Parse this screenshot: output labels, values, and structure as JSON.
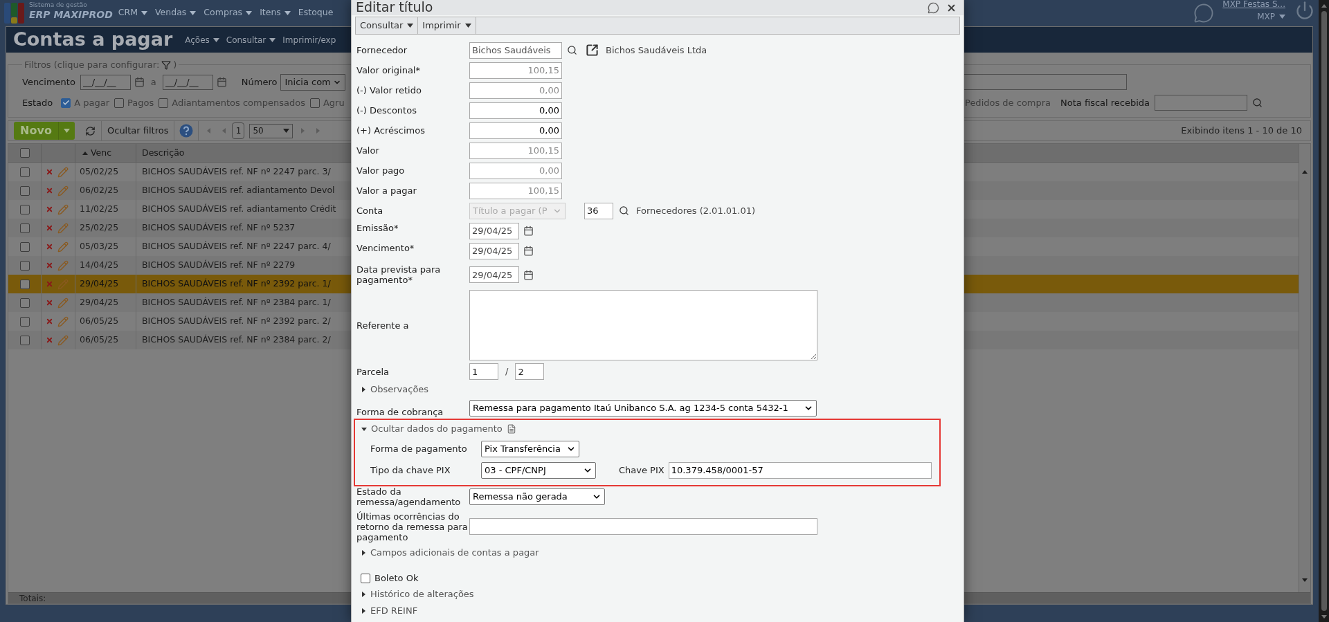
{
  "top_nav": {
    "logo_caption": "Sistema de gestão",
    "logo_text": "ERP MAXIPROD",
    "menu": [
      {
        "label": "CRM",
        "caret": true
      },
      {
        "label": "Vendas",
        "caret": true
      },
      {
        "label": "Compras",
        "caret": true
      },
      {
        "label": "Itens",
        "caret": true
      },
      {
        "label": "Estoque",
        "caret": false
      }
    ],
    "company_link": "MXP Festas S...",
    "user_menu": "MXP"
  },
  "page": {
    "title": "Contas a pagar",
    "menu": [
      {
        "label": "Ações",
        "caret": true
      },
      {
        "label": "Consultar",
        "caret": true
      },
      {
        "label": "Imprimir/exp",
        "caret": false
      }
    ]
  },
  "filters": {
    "legend": "Filtros (clique para configurar:",
    "legend_end": ")",
    "due_label": "Vencimento",
    "date_from": "__/__/__",
    "between": "a",
    "date_to": "__/__/__",
    "number_label": "Número",
    "number_mode": "Inicia com",
    "state_label": "Estado",
    "states": [
      {
        "label": "A pagar",
        "checked": true
      },
      {
        "label": "Pagos",
        "checked": false
      },
      {
        "label": "Adiantamentos compensados",
        "checked": false
      },
      {
        "label": "Agru",
        "checked": false
      }
    ],
    "purchase_orders_label": "Pedidos de compra",
    "invoice_label": "Nota fiscal recebida"
  },
  "toolbar": {
    "new_button": "Novo",
    "hide_filters": "Ocultar filtros",
    "page": "1",
    "page_size": "50",
    "summary": "Exibindo itens 1 - 10 de 10"
  },
  "grid": {
    "all_checked": false,
    "columns": [
      "Venc",
      "Descrição"
    ],
    "rows": [
      {
        "venc": "05/02/25",
        "description": "BICHOS SAUDÁVEIS ref. NF nº 2247 parc. 3/",
        "selected": false,
        "checked": false
      },
      {
        "venc": "06/02/25",
        "description": "BICHOS SAUDÁVEIS ref. adiantamento Devol",
        "selected": false,
        "checked": false
      },
      {
        "venc": "11/02/25",
        "description": "BICHOS SAUDÁVEIS ref. adiantamento Crédit",
        "selected": false,
        "checked": false
      },
      {
        "venc": "25/02/25",
        "description": "BICHOS SAUDÁVEIS ref. NF nº 5237",
        "selected": false,
        "checked": false
      },
      {
        "venc": "05/03/25",
        "description": "BICHOS SAUDÁVEIS ref. NF nº 2247 parc. 4/",
        "selected": false,
        "checked": false
      },
      {
        "venc": "14/04/25",
        "description": "BICHOS SAUDÁVEIS ref. NF nº 2279",
        "selected": false,
        "checked": false
      },
      {
        "venc": "29/04/25",
        "description": "BICHOS SAUDÁVEIS ref. NF nº 2392 parc. 1/",
        "selected": true,
        "checked": false
      },
      {
        "venc": "29/04/25",
        "description": "BICHOS SAUDÁVEIS ref. NF nº 2384 parc. 1/",
        "selected": false,
        "checked": false
      },
      {
        "venc": "06/05/25",
        "description": "BICHOS SAUDÁVEIS ref. NF nº 2392 parc. 2/",
        "selected": false,
        "checked": false
      },
      {
        "venc": "06/05/25",
        "description": "BICHOS SAUDÁVEIS ref. NF nº 2384 parc. 2/",
        "selected": false,
        "checked": false
      }
    ],
    "totals_label": "Totais:"
  },
  "dialog": {
    "title": "Editar título",
    "toolbar": [
      "Consultar",
      "Imprimir"
    ],
    "fields": [
      {
        "kind": "supplier",
        "label": "Fornecedor",
        "value": "Bichos Saudáveis",
        "link": "Bichos Saudáveis Ltda"
      },
      {
        "kind": "amount",
        "label": "Valor original*",
        "value": "100,15",
        "editable": false
      },
      {
        "kind": "amount",
        "label": "(-) Valor retido",
        "value": "0,00",
        "editable": false
      },
      {
        "kind": "amount",
        "label": "(-) Descontos",
        "value": "0,00",
        "editable": true
      },
      {
        "kind": "amount",
        "label": "(+) Acréscimos",
        "value": "0,00",
        "editable": true
      },
      {
        "kind": "amount",
        "label": "Valor",
        "value": "100,15",
        "editable": false
      },
      {
        "kind": "amount",
        "label": "Valor pago",
        "value": "0,00",
        "editable": false
      },
      {
        "kind": "amount",
        "label": "Valor a pagar",
        "value": "100,15",
        "editable": false
      },
      {
        "kind": "account",
        "label": "Conta",
        "value": "Título a pagar (P",
        "disabled": true,
        "code": "36",
        "account_name": "Fornecedores (2.01.01.01)"
      },
      {
        "kind": "date",
        "label": "Emissão*",
        "value": "29/04/25"
      },
      {
        "kind": "date",
        "label": "Vencimento*",
        "value": "29/04/25"
      },
      {
        "kind": "date",
        "label": "Data prevista para pagamento*",
        "value": "29/04/25"
      },
      {
        "kind": "textarea",
        "label": "Referente a"
      },
      {
        "kind": "installment",
        "label": "Parcela",
        "value": "1",
        "separator": "/",
        "total": "2"
      },
      {
        "kind": "section",
        "label": "Observações",
        "expanded": false
      },
      {
        "kind": "wide_select",
        "label": "Forma de cobrança",
        "value": "Remessa para pagamento Itaú Unibanco S.A. ag 1234-5 conta 5432-1"
      },
      {
        "kind": "payment_group",
        "label": "Ocultar dados do pagamento",
        "expanded": true,
        "highlighted": true,
        "method_label": "Forma de pagamento",
        "method": "Pix Transferência",
        "key_type_label": "Tipo da chave PIX",
        "key_type": "03 - CPF/CNPJ",
        "key_label": "Chave PIX",
        "key": "10.379.458/0001-57"
      },
      {
        "kind": "select",
        "label": "Estado da remessa/agendamento",
        "value": "Remessa não gerada"
      },
      {
        "kind": "text",
        "label": "Últimas ocorrências do retorno da remessa para pagamento"
      },
      {
        "kind": "section",
        "label": "Campos adicionais de contas a pagar",
        "expanded": false
      },
      {
        "kind": "checkbox",
        "label": "Boleto Ok",
        "checked": false
      },
      {
        "kind": "section",
        "label": "Histórico de alterações",
        "expanded": false
      },
      {
        "kind": "section",
        "label": "EFD REINF",
        "expanded": false
      }
    ]
  }
}
